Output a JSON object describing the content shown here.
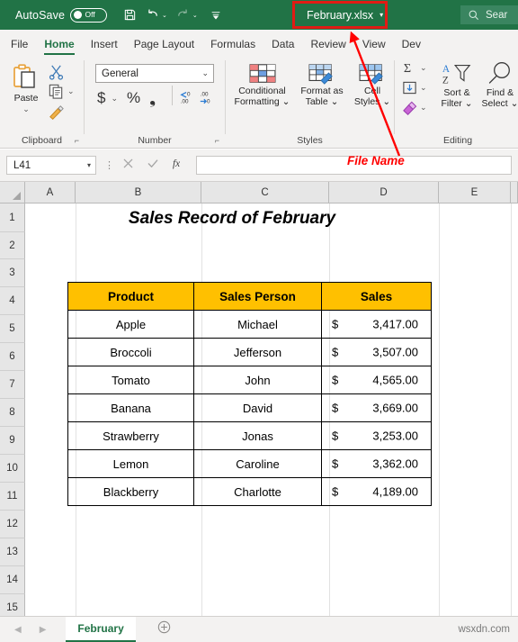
{
  "titlebar": {
    "autosave_label": "AutoSave",
    "autosave_state": "Off",
    "save_icon": "save-icon",
    "undo_icon": "undo-icon",
    "redo_icon": "redo-icon",
    "customize_icon": "customize-quick-access-icon",
    "file_name": "February.xlsx",
    "file_name_caret": "▾",
    "search_placeholder": "Sear",
    "search_icon": "search-icon",
    "bar_color": "#217346",
    "highlight_color": "#e11b14"
  },
  "ribbon": {
    "tabs": [
      {
        "label": "File",
        "active": false
      },
      {
        "label": "Home",
        "active": true
      },
      {
        "label": "Insert",
        "active": false
      },
      {
        "label": "Page Layout",
        "active": false
      },
      {
        "label": "Formulas",
        "active": false
      },
      {
        "label": "Data",
        "active": false
      },
      {
        "label": "Review",
        "active": false
      },
      {
        "label": "View",
        "active": false
      },
      {
        "label": "Dev",
        "active": false
      }
    ],
    "groups": {
      "clipboard": {
        "label": "Clipboard",
        "paste_label": "Paste",
        "paste_caret": "⌄",
        "cut_icon": "scissors-icon",
        "copy_icon": "copy-icon",
        "copy_caret": "⌄",
        "format_painter_icon": "format-painter-icon",
        "launcher": "⌐"
      },
      "number": {
        "label": "Number",
        "format_value": "General",
        "format_caret": "⌄",
        "currency_label": "$",
        "currency_caret": "⌄",
        "percent_label": "%",
        "comma_label": "❟",
        "increase_decimal_icon": "increase-decimal-icon",
        "decrease_decimal_icon": "decrease-decimal-icon",
        "launcher": "⌐"
      },
      "styles": {
        "label": "Styles",
        "conditional_formatting_line1": "Conditional",
        "conditional_formatting_line2": "Formatting ⌄",
        "format_as_table_line1": "Format as",
        "format_as_table_line2": "Table ⌄",
        "cell_styles_line1": "Cell",
        "cell_styles_line2": "Styles ⌄"
      },
      "editing": {
        "label": "Editing",
        "autosum_icon": "sigma-icon",
        "fill_icon": "fill-down-icon",
        "clear_icon": "eraser-icon",
        "sort_filter_line1": "Sort &",
        "sort_filter_line2": "Filter ⌄",
        "find_select_line1": "Find &",
        "find_select_line2": "Select ⌄"
      }
    }
  },
  "formula_bar": {
    "name_box_value": "L41",
    "name_box_caret": "▾",
    "cancel_icon": "cancel-icon",
    "enter_icon": "confirm-icon",
    "function_icon": "insert-function-icon",
    "formula_value": ""
  },
  "sheet": {
    "columns": [
      "A",
      "B",
      "C",
      "D",
      "E"
    ],
    "rows": [
      "1",
      "2",
      "3",
      "4",
      "5",
      "6",
      "7",
      "8",
      "9",
      "10",
      "11",
      "12",
      "13",
      "14",
      "15"
    ],
    "title": "Sales Record of February",
    "header_fill": "#ffc000",
    "table": {
      "headers": [
        "Product",
        "Sales Person",
        "Sales"
      ],
      "rows": [
        {
          "product": "Apple",
          "person": "Michael",
          "currency": "$",
          "amount": "3,417.00"
        },
        {
          "product": "Broccoli",
          "person": "Jefferson",
          "currency": "$",
          "amount": "3,507.00"
        },
        {
          "product": "Tomato",
          "person": "John",
          "currency": "$",
          "amount": "4,565.00"
        },
        {
          "product": "Banana",
          "person": "David",
          "currency": "$",
          "amount": "3,669.00"
        },
        {
          "product": "Strawberry",
          "person": "Jonas",
          "currency": "$",
          "amount": "3,253.00"
        },
        {
          "product": "Lemon",
          "person": "Caroline",
          "currency": "$",
          "amount": "3,362.00"
        },
        {
          "product": "Blackberry",
          "person": "Charlotte",
          "currency": "$",
          "amount": "4,189.00"
        }
      ]
    }
  },
  "annotation": {
    "label": "File Name",
    "color": "#ff0000"
  },
  "sheet_tabs": {
    "prev_arrow": "◀",
    "next_arrow": "▶",
    "active_sheet": "February",
    "add_sheet_icon": "add-sheet-icon",
    "watermark": "wsxdn.com"
  }
}
